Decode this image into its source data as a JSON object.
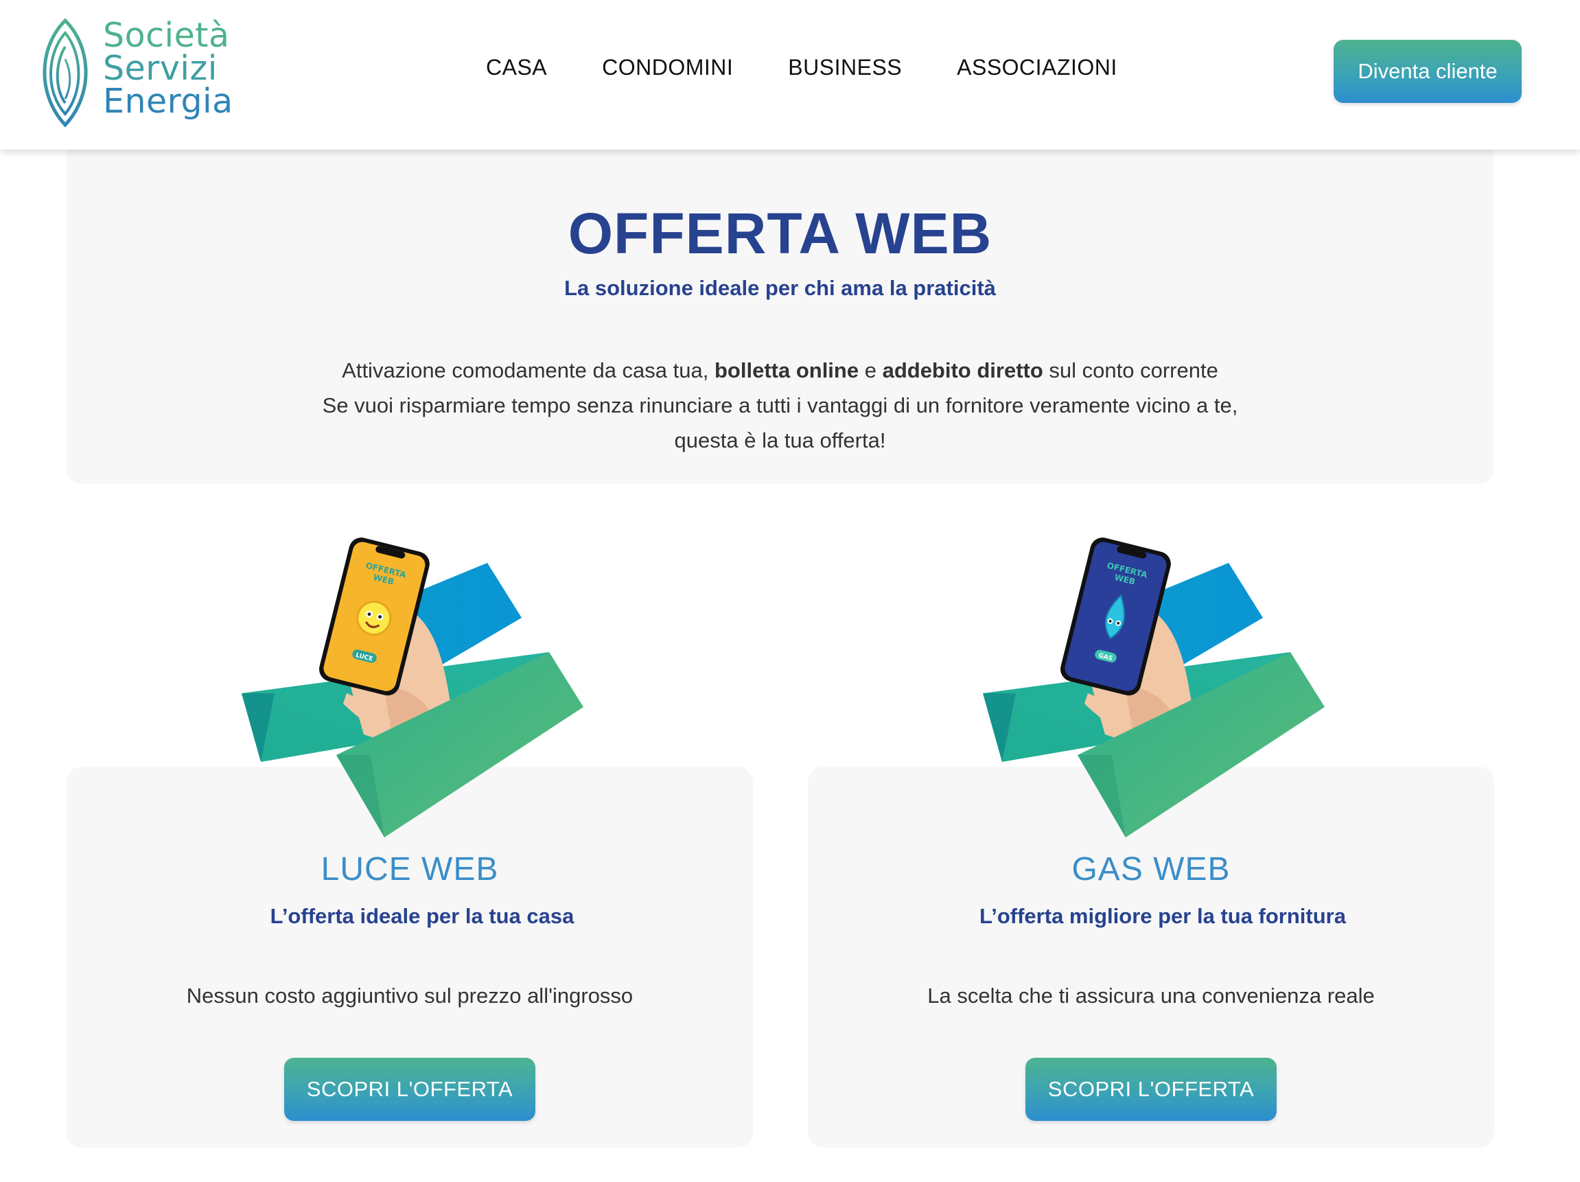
{
  "brand": {
    "name_line1": "Società",
    "name_line2": "Servizi",
    "name_line3": "Energia",
    "colors": {
      "green": "#4eb28c",
      "teal": "#3f9fa3",
      "blue": "#2f85b6",
      "navy": "#27428f",
      "accent_blue": "#3a8ec8"
    }
  },
  "header": {
    "nav": [
      {
        "label": "CASA"
      },
      {
        "label": "CONDOMINI"
      },
      {
        "label": "BUSINESS"
      },
      {
        "label": "ASSOCIAZIONI"
      }
    ],
    "cta_label": "Diventa cliente"
  },
  "hero": {
    "title": "OFFERTA WEB",
    "subtitle": "La soluzione ideale per chi ama la praticità",
    "line1_a": "Attivazione comodamente da casa tua, ",
    "line1_b": "bolletta online",
    "line1_c": " e ",
    "line1_d": "addebito diretto",
    "line1_e": " sul conto corrente",
    "line2": "Se vuoi risparmiare tempo senza rinunciare a tutti i vantaggi di un fornitore veramente vicino a te,",
    "line3": "questa è la tua offerta!"
  },
  "cards": [
    {
      "title": "LUCE WEB",
      "subtitle": "L’offerta ideale per la tua casa",
      "description": "Nessun costo aggiuntivo sul prezzo all'ingrosso",
      "button_label": "SCOPRI L'OFFERTA",
      "phone_text_1": "OFFERTA",
      "phone_text_2": "WEB",
      "phone_badge": "LUCE",
      "phone_color": "#f7b52c",
      "icon": "lightbulb-mascot-icon"
    },
    {
      "title": "GAS WEB",
      "subtitle": "L’offerta migliore per la tua fornitura",
      "description": "La scelta che ti assicura una convenienza reale",
      "button_label": "SCOPRI L'OFFERTA",
      "phone_text_1": "OFFERTA",
      "phone_text_2": "WEB",
      "phone_badge": "GAS",
      "phone_color": "#2a3f9a",
      "icon": "gas-flame-mascot-icon"
    }
  ]
}
